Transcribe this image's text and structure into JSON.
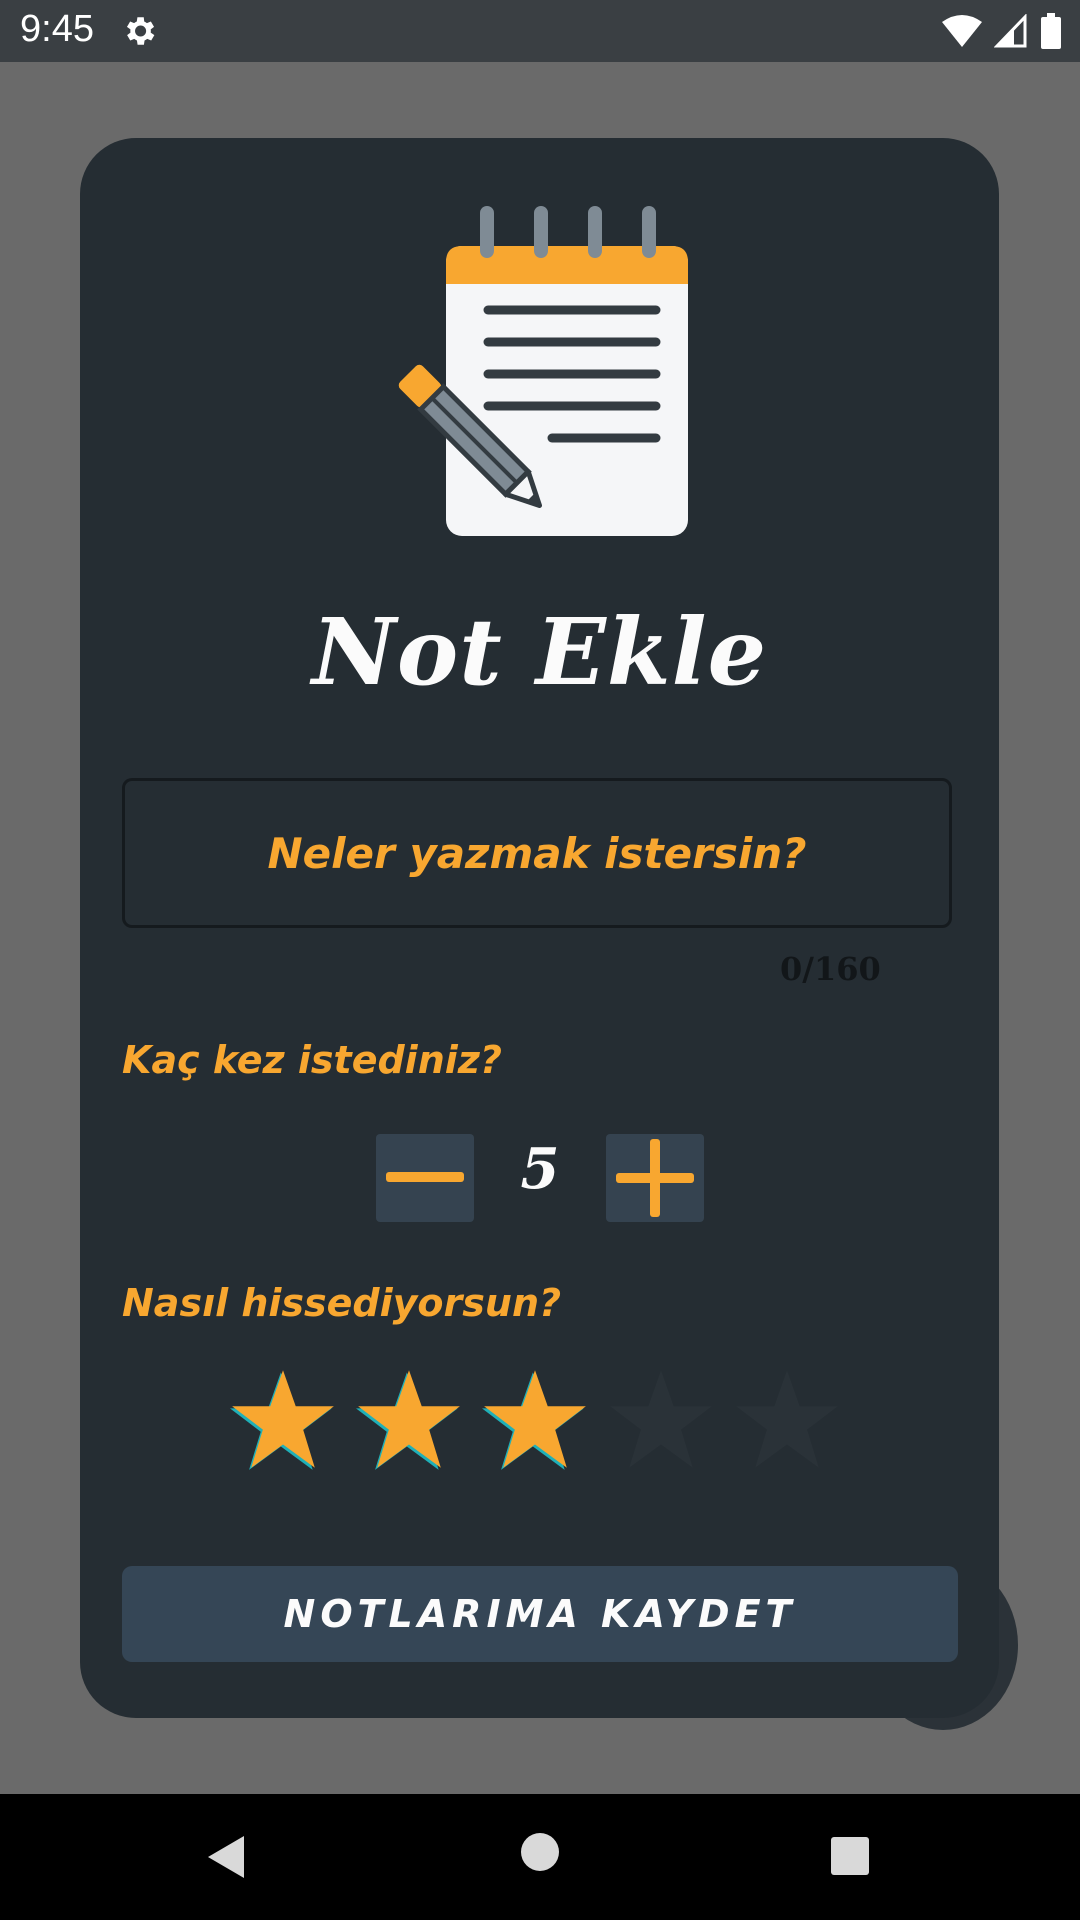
{
  "status_bar": {
    "time": "9:45",
    "icons": [
      "gear-icon",
      "wifi-icon",
      "signal-icon",
      "battery-icon"
    ]
  },
  "dialog": {
    "title": "Not Ekle",
    "note_input": {
      "placeholder": "Neler yazmak istersin?",
      "value": "",
      "counter": "0/160"
    },
    "quantity": {
      "label": "Kaç kez istediniz?",
      "value": "5"
    },
    "feeling": {
      "label": "Nasıl hissediyorsun?",
      "rating": 3,
      "max": 5
    },
    "save_label": "NOTLARIMA KAYDET"
  },
  "colors": {
    "accent": "#f8a730",
    "dialog_bg": "#252d33",
    "button_bg": "#354656",
    "star_empty": "#2a3238"
  }
}
